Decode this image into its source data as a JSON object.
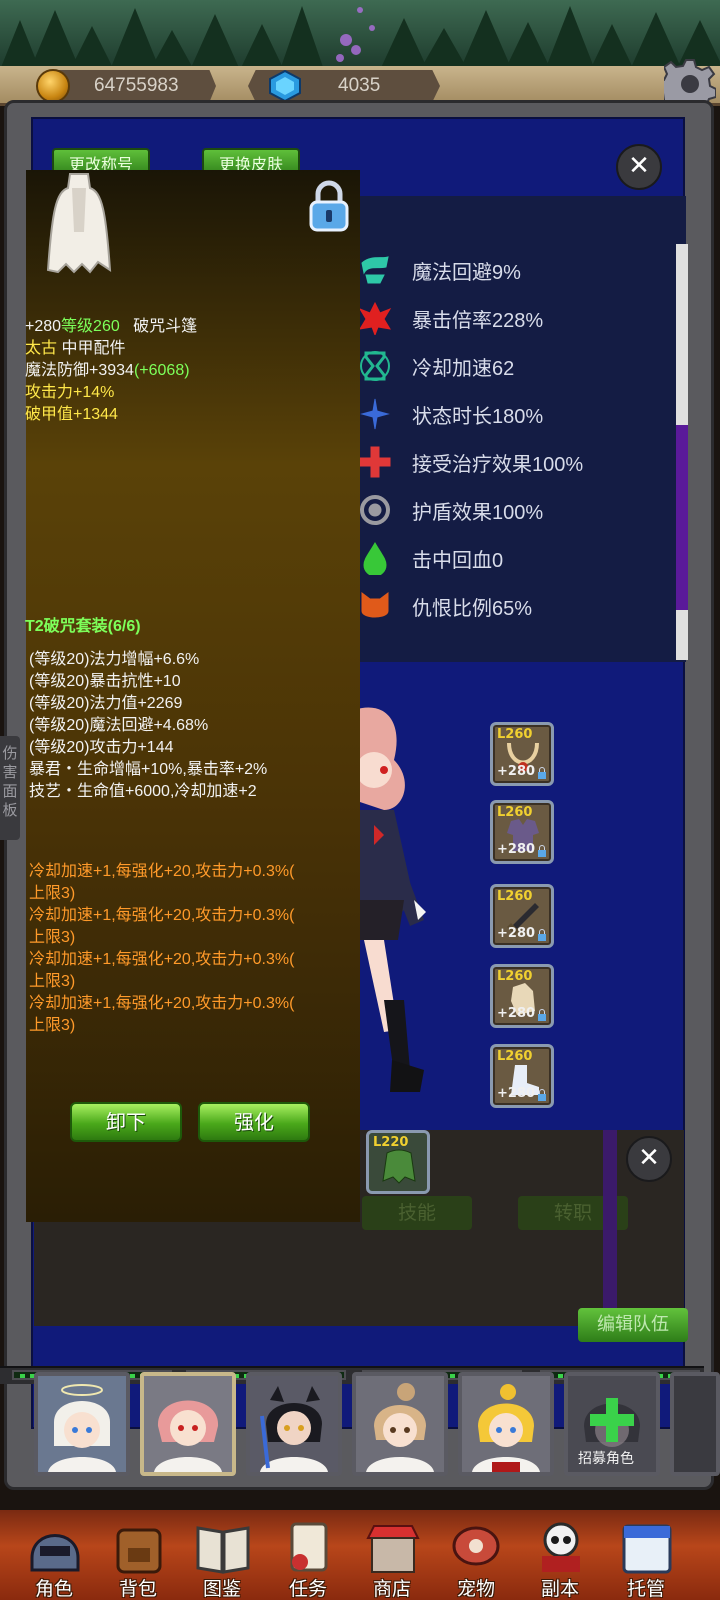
{
  "resources": {
    "gold": "64755983",
    "gems": "4035"
  },
  "main": {
    "tab_title": "更改称号",
    "tab_skin": "更换皮肤"
  },
  "stats": [
    {
      "label": "魔法回避9%",
      "icon": "wind-icon",
      "color": "#2ec8a8"
    },
    {
      "label": "暴击倍率228%",
      "icon": "crit-icon",
      "color": "#e02020"
    },
    {
      "label": "冷却加速62",
      "icon": "hourglass-icon",
      "color": "#22b890"
    },
    {
      "label": "状态时长180%",
      "icon": "duration-icon",
      "color": "#3a6ad8"
    },
    {
      "label": "接受治疗效果100%",
      "icon": "heal-cross-icon",
      "color": "#e03838"
    },
    {
      "label": "护盾效果100%",
      "icon": "shield-ring-icon",
      "color": "#9a9aa0"
    },
    {
      "label": "击中回血0",
      "icon": "blood-drop-icon",
      "color": "#38c838"
    },
    {
      "label": "仇恨比例65%",
      "icon": "demon-face-icon",
      "color": "#e05a1a"
    }
  ],
  "equipment": [
    {
      "level": "L260",
      "plus": "+280",
      "icon": "necklace-icon"
    },
    {
      "level": "L260",
      "plus": "+280",
      "icon": "armor-icon"
    },
    {
      "level": "L260",
      "plus": "+280",
      "icon": "sword-icon"
    },
    {
      "level": "L260",
      "plus": "+280",
      "icon": "gloves-icon"
    },
    {
      "level": "L260",
      "plus": "+280",
      "icon": "boots-icon"
    }
  ],
  "mini_slot": {
    "level": "L220",
    "icon": "cloak-icon"
  },
  "sub_tabs": {
    "skills": "技能",
    "job_change": "转职",
    "edit_team": "编辑队伍"
  },
  "tooltip": {
    "enhance_prefix": "+280",
    "level": "等级260",
    "item_name": "破咒斗篷",
    "tier": "太古",
    "slot_type": "中甲配件",
    "main_stat": "魔法防御+3934",
    "main_bonus": "(+6068)",
    "sub_stat_1": "攻击力+14%",
    "sub_stat_2": "破甲值+1344",
    "set_title": "T2破咒套装(6/6)",
    "set_bonuses": [
      "(等级20)法力增幅+6.6%",
      "(等级20)暴击抗性+10",
      "(等级20)法力值+2269",
      "(等级20)魔法回避+4.68%",
      "(等级20)攻击力+144",
      "暴君・生命增幅+10%,暴击率+2%",
      "技艺・生命值+6000,冷却加速+2"
    ],
    "special": [
      "冷却加速+1,每强化+20,攻击力+0.3%(",
      "上限3)",
      "冷却加速+1,每强化+20,攻击力+0.3%(",
      "上限3)",
      "冷却加速+1,每强化+20,攻击力+0.3%(",
      "上限3)",
      "冷却加速+1,每强化+20,攻击力+0.3%(",
      "上限3)"
    ],
    "unequip": "卸下",
    "enhance": "强化"
  },
  "side_tab": "伤害面板",
  "roster": {
    "recruit": "招募角色"
  },
  "nav": [
    {
      "label": "角色",
      "icon": "helmet-icon"
    },
    {
      "label": "背包",
      "icon": "backpack-icon"
    },
    {
      "label": "图鉴",
      "icon": "book-icon"
    },
    {
      "label": "任务",
      "icon": "scroll-icon"
    },
    {
      "label": "商店",
      "icon": "shop-icon"
    },
    {
      "label": "宠物",
      "icon": "meat-icon"
    },
    {
      "label": "副本",
      "icon": "skull-icon"
    },
    {
      "label": "托管",
      "icon": "calendar-icon"
    }
  ]
}
